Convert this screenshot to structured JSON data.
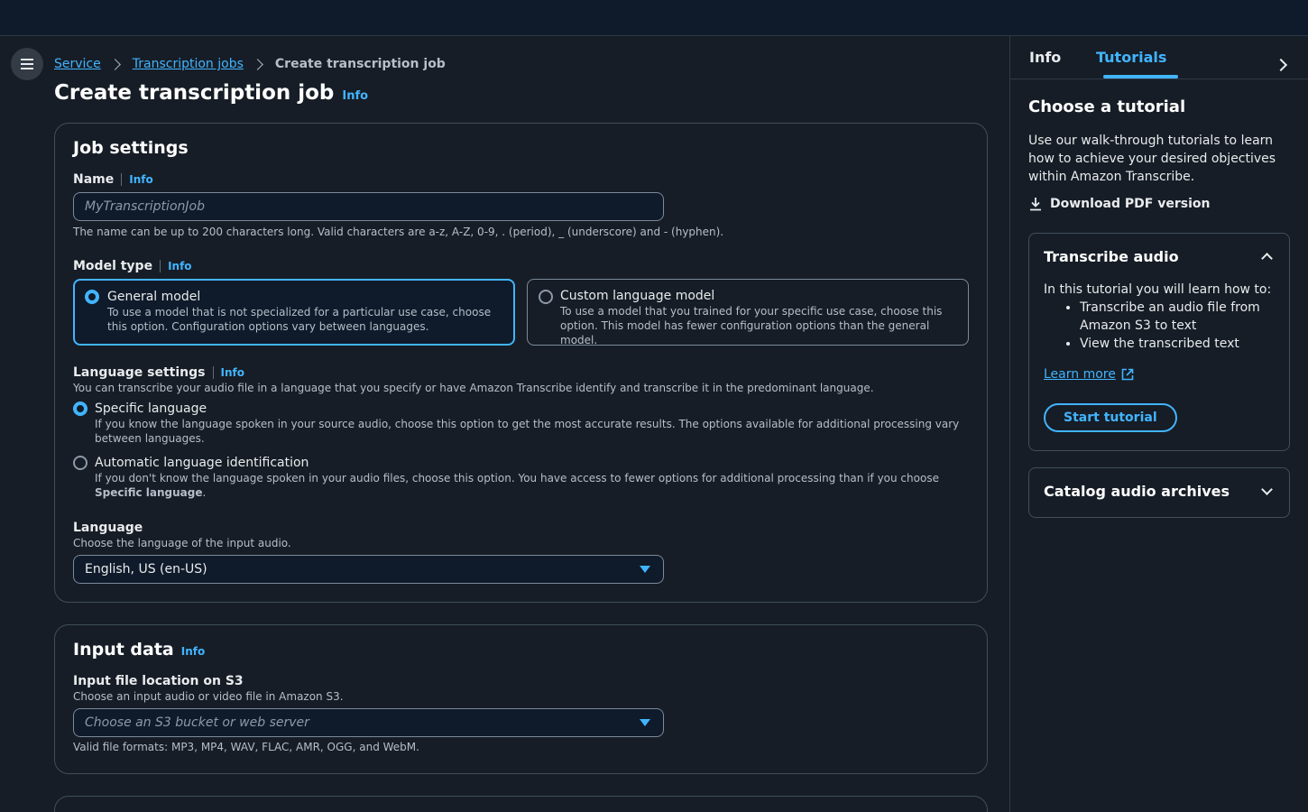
{
  "breadcrumb": {
    "items": [
      "Service",
      "Transcription jobs"
    ],
    "current": "Create transcription job"
  },
  "page": {
    "title": "Create transcription job",
    "info": "Info"
  },
  "job_settings": {
    "title": "Job settings",
    "name": {
      "label": "Name",
      "info": "Info",
      "placeholder": "MyTranscriptionJob",
      "hint": "The name can be up to 200 characters long. Valid characters are a-z, A-Z, 0-9, . (period), _ (underscore) and - (hyphen)."
    },
    "model_type": {
      "label": "Model type",
      "info": "Info",
      "options": [
        {
          "title": "General model",
          "desc": "To use a model that is not specialized for a particular use case, choose this option. Configuration options vary between languages.",
          "selected": true
        },
        {
          "title": "Custom language model",
          "desc": "To use a model that you trained for your specific use case, choose this option. This model has fewer configuration options than the general model.",
          "selected": false
        }
      ]
    },
    "language_settings": {
      "label": "Language settings",
      "info": "Info",
      "desc": "You can transcribe your audio file in a language that you specify or have Amazon Transcribe identify and transcribe it in the predominant language.",
      "options": [
        {
          "title": "Specific language",
          "desc": "If you know the language spoken in your source audio, choose this option to get the most accurate results. The options available for additional processing vary between languages.",
          "selected": true
        },
        {
          "title": "Automatic language identification",
          "desc_pre": "If you don't know the language spoken in your audio files, choose this option. You have access to fewer options for additional processing than if you choose ",
          "desc_bold": "Specific language",
          "desc_post": ".",
          "selected": false
        }
      ]
    },
    "language": {
      "label": "Language",
      "desc": "Choose the language of the input audio.",
      "value": "English, US (en-US)"
    }
  },
  "input_data": {
    "title": "Input data",
    "info": "Info",
    "location": {
      "label": "Input file location on S3",
      "desc": "Choose an input audio or video file in Amazon S3.",
      "placeholder": "Choose an S3 bucket or web server",
      "hint": "Valid file formats: MP3, MP4, WAV, FLAC, AMR, OGG, and WebM."
    }
  },
  "side_panel": {
    "tabs": [
      "Info",
      "Tutorials"
    ],
    "active_tab": "Tutorials",
    "title": "Choose a tutorial",
    "text": "Use our walk-through tutorials to learn how to achieve your desired objectives within Amazon Transcribe.",
    "download": "Download PDF version",
    "tutorials": [
      {
        "title": "Transcribe audio",
        "expanded": true,
        "intro": "In this tutorial you will learn how to:",
        "bullets": [
          "Transcribe an audio file from Amazon S3 to text",
          "View the transcribed text"
        ],
        "learn_more": "Learn more",
        "button": "Start tutorial"
      },
      {
        "title": "Catalog audio archives",
        "expanded": false
      }
    ]
  },
  "colors": {
    "accent": "#42b4ff",
    "background": "#161d26",
    "topbar": "#0f1b2a"
  }
}
